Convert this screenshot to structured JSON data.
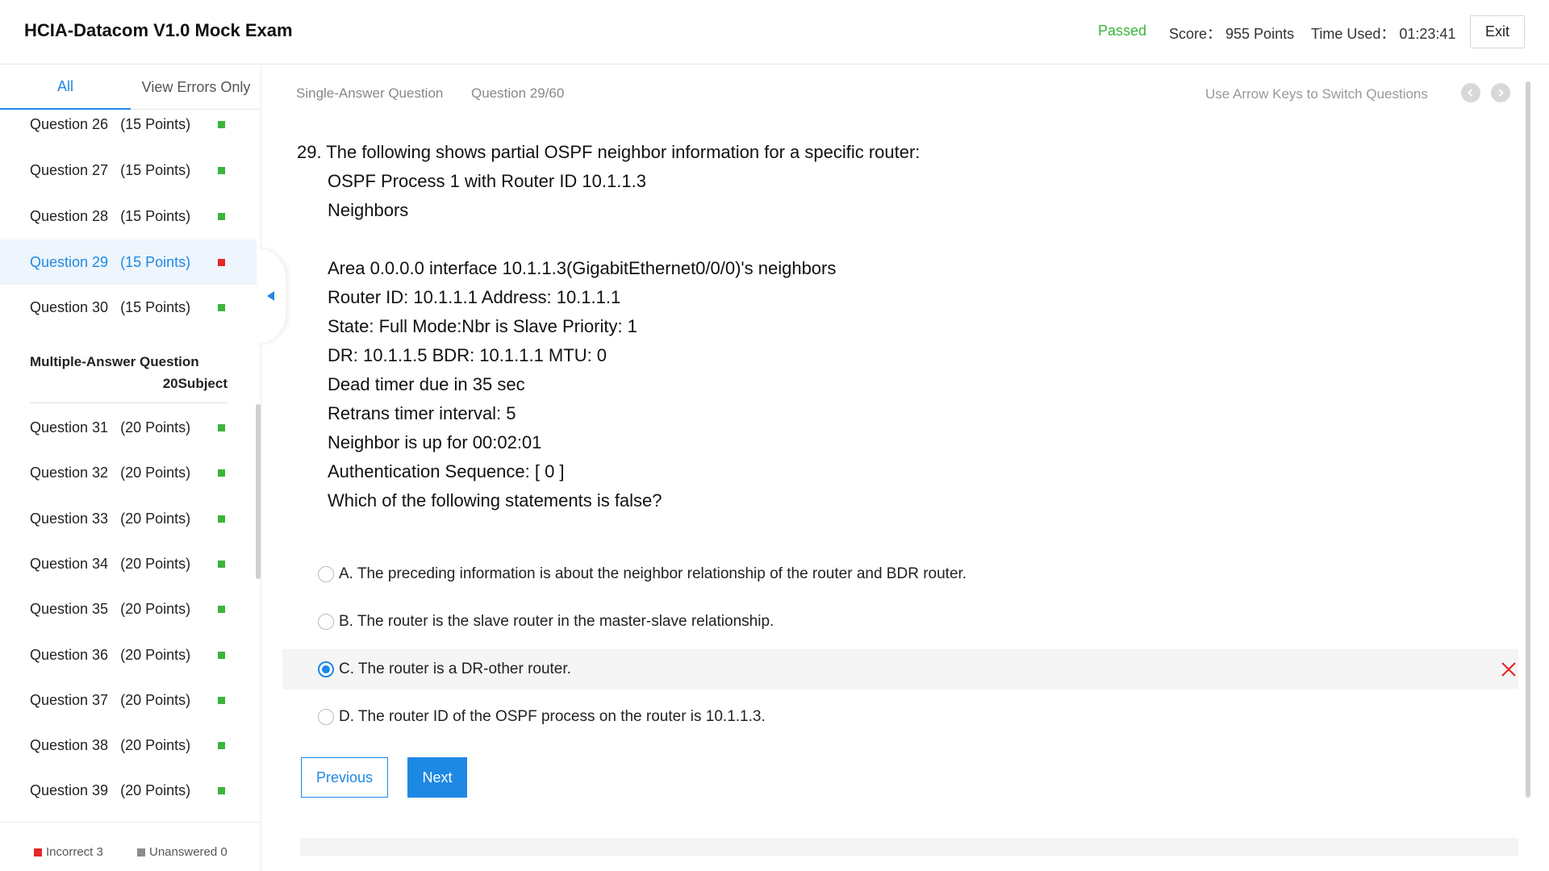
{
  "header": {
    "title": "HCIA-Datacom V1.0 Mock Exam",
    "status": "Passed",
    "score": "Score： 955 Points",
    "time_used": "Time Used： 01:23:41",
    "exit_label": "Exit",
    "status_color": "#3cb43c"
  },
  "sidebar": {
    "tabs": {
      "all": "All",
      "errors": "View Errors Only"
    },
    "items_top": [
      {
        "label": "Question 26   (15 Points)",
        "status": "correct"
      },
      {
        "label": "Question 27   (15 Points)",
        "status": "correct"
      },
      {
        "label": "Question 28   (15 Points)",
        "status": "correct"
      },
      {
        "label": "Question 29   (15 Points)",
        "status": "incorrect",
        "active": true
      },
      {
        "label": "Question 30   (15 Points)",
        "status": "correct"
      }
    ],
    "section": {
      "title": "Multiple-Answer Question",
      "subtitle": "20Subject"
    },
    "items_bottom": [
      {
        "label": "Question 31   (20 Points)",
        "status": "correct"
      },
      {
        "label": "Question 32   (20 Points)",
        "status": "correct"
      },
      {
        "label": "Question 33   (20 Points)",
        "status": "correct"
      },
      {
        "label": "Question 34   (20 Points)",
        "status": "correct"
      },
      {
        "label": "Question 35   (20 Points)",
        "status": "correct"
      },
      {
        "label": "Question 36   (20 Points)",
        "status": "correct"
      },
      {
        "label": "Question 37   (20 Points)",
        "status": "correct"
      },
      {
        "label": "Question 38   (20 Points)",
        "status": "correct"
      },
      {
        "label": "Question 39   (20 Points)",
        "status": "correct"
      }
    ],
    "legend": {
      "incorrect": "Incorrect 3",
      "unanswered": "Unanswered 0"
    },
    "colors": {
      "correct": "#3cb43c",
      "incorrect": "#e52727",
      "unanswered": "#8c8c8c",
      "accent": "#1e88e5"
    }
  },
  "main": {
    "question_type": "Single-Answer Question",
    "counter": "Question 29/60",
    "arrow_hint": "Use Arrow Keys to Switch Questions",
    "question_lines": [
      "29. The following shows partial OSPF neighbor information for a specific router:",
      "OSPF Process 1 with Router ID 10.1.1.3",
      "Neighbors",
      "",
      "Area 0.0.0.0 interface 10.1.1.3(GigabitEthernet0/0/0)'s neighbors",
      "Router ID: 10.1.1.1 Address: 10.1.1.1",
      "State: Full Mode:Nbr is Slave Priority: 1",
      "DR: 10.1.1.5 BDR: 10.1.1.1 MTU: 0",
      "Dead timer due in 35 sec",
      "Retrans timer interval: 5",
      "Neighbor is up for 00:02:01",
      "Authentication Sequence: [ 0 ]",
      "Which of the following statements is false?"
    ],
    "options": [
      {
        "text": "A. The preceding information is about the neighbor relationship of the router and BDR router.",
        "selected": false
      },
      {
        "text": "B. The router is the slave router in the master-slave relationship.",
        "selected": false
      },
      {
        "text": "C. The router is a DR-other router.",
        "selected": true,
        "wrong": true
      },
      {
        "text": "D. The router ID of the OSPF process on the router is 10.1.1.3.",
        "selected": false
      }
    ],
    "prev_label": "Previous",
    "next_label": "Next",
    "icons": {
      "prev": "chevron-left-icon",
      "next": "chevron-right-icon",
      "wrong": "close-icon"
    }
  }
}
